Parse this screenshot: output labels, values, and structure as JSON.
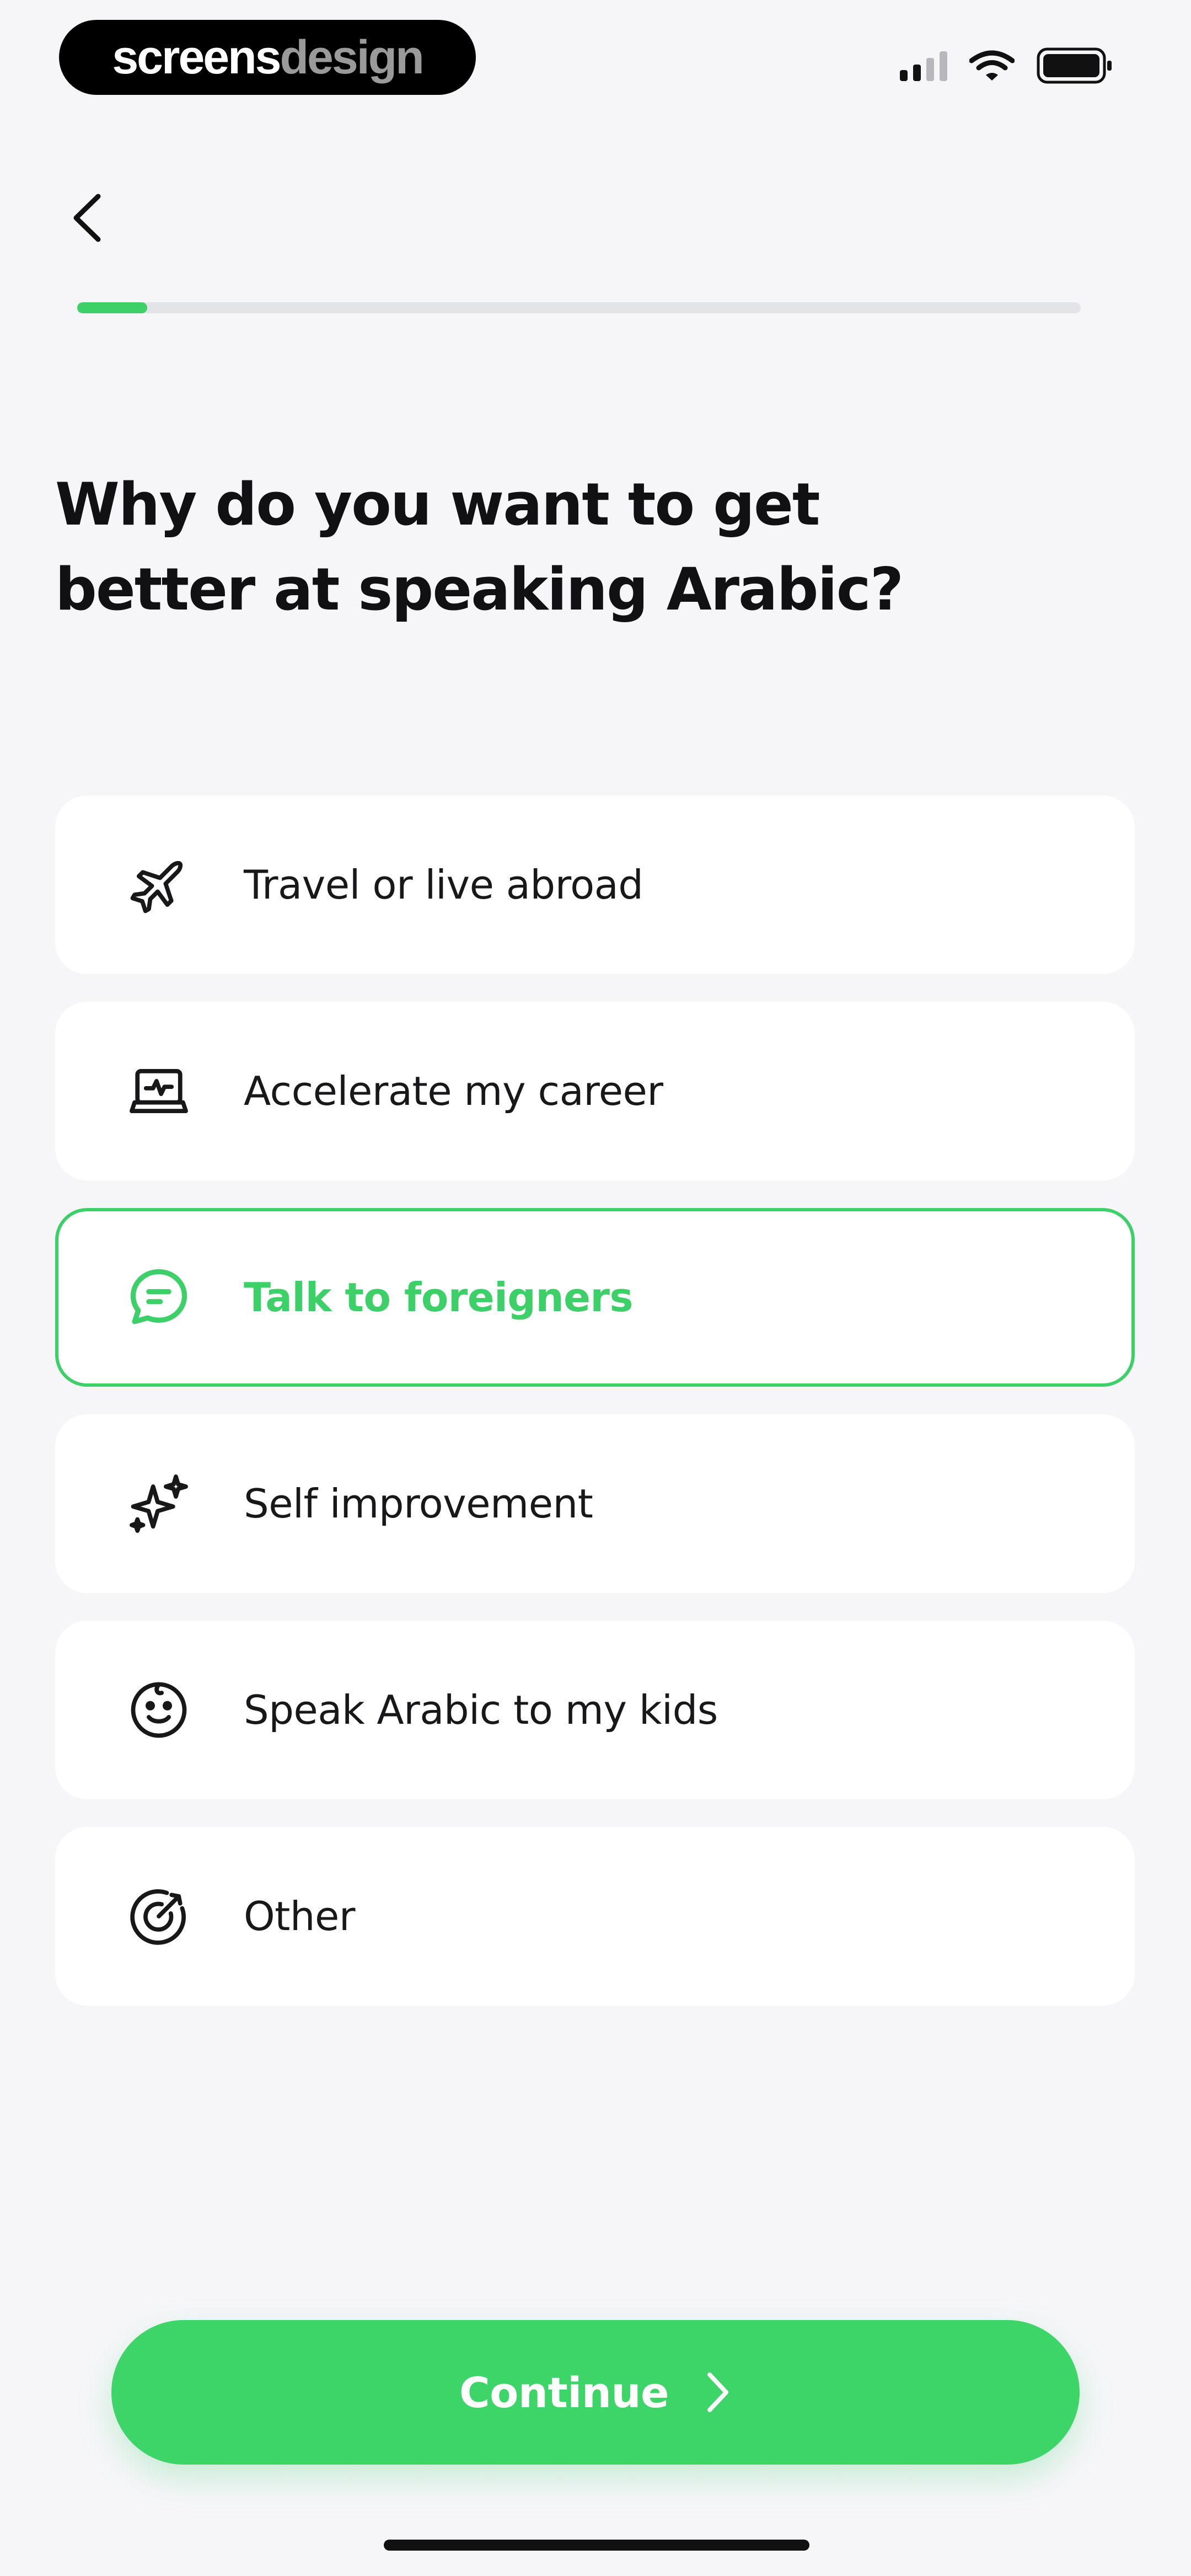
{
  "watermark": {
    "part1": "screens",
    "part2": "design"
  },
  "header": {
    "back_icon": "chevron-left-icon"
  },
  "progress": {
    "value_percent": 7
  },
  "question": {
    "line1": "Why do you want to get",
    "line2": "better at speaking Arabic?"
  },
  "options": [
    {
      "label": "Travel or live abroad",
      "icon": "airplane-icon",
      "selected": false
    },
    {
      "label": "Accelerate my career",
      "icon": "laptop-icon",
      "selected": false
    },
    {
      "label": "Talk to foreigners",
      "icon": "chat-bubble-icon",
      "selected": true
    },
    {
      "label": "Self improvement",
      "icon": "sparkles-icon",
      "selected": false
    },
    {
      "label": "Speak Arabic to my kids",
      "icon": "smiley-face-icon",
      "selected": false
    },
    {
      "label": "Other",
      "icon": "target-icon",
      "selected": false
    }
  ],
  "continue_button": {
    "label": "Continue",
    "icon": "chevron-right-icon"
  },
  "colors": {
    "accent": "#3dd068",
    "background": "#f6f6f9",
    "text": "#111114"
  }
}
